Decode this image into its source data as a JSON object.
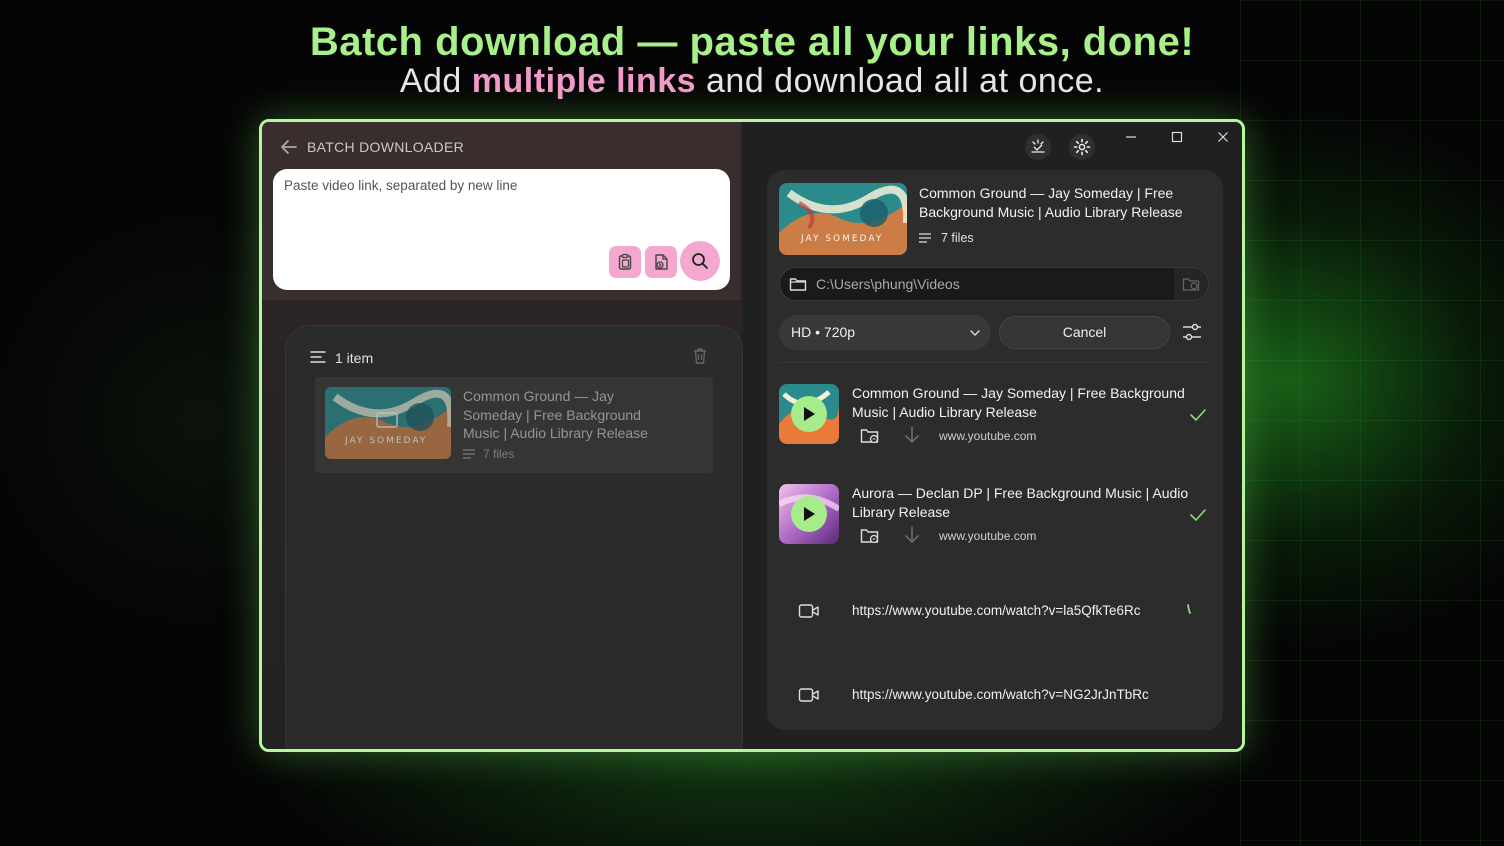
{
  "headline": "Batch download — paste all your links, done!",
  "subline": {
    "before": "Add ",
    "accent": "multiple links",
    "after": " and download all at once."
  },
  "left": {
    "title": "BATCH DOWNLOADER",
    "paste_placeholder": "Paste video link, separated by new line",
    "queue_count": "1 item",
    "queue_item": {
      "title": "Common Ground — Jay Someday | Free Background Music | Audio Library Release",
      "files": "7 files",
      "thumb_text": "JAY SOMEDAY"
    }
  },
  "right": {
    "playlist": {
      "title": "Common Ground — Jay Someday | Free Background Music | Audio Library Release",
      "files": "7 files",
      "thumb_text": "JAY SOMEDAY"
    },
    "path": "C:\\Users\\phung\\Videos",
    "quality": "HD • 720p",
    "cancel_label": "Cancel",
    "downloads": [
      {
        "title": "Common Ground — Jay Someday | Free Background Music | Audio Library Release",
        "source": "www.youtube.com",
        "status": "done"
      },
      {
        "title": "Aurora — Declan DP | Free Background Music | Audio Library Release",
        "source": "www.youtube.com",
        "status": "done"
      }
    ],
    "pending": [
      {
        "url": "https://www.youtube.com/watch?v=la5QfkTe6Rc",
        "status": "loading"
      },
      {
        "url": "https://www.youtube.com/watch?v=NG2JrJnTbRc",
        "status": "queued"
      }
    ]
  },
  "colors": {
    "accent_green": "#a6ec8a",
    "accent_pink": "#f5a8cf",
    "frame": "#b8f5a0"
  }
}
